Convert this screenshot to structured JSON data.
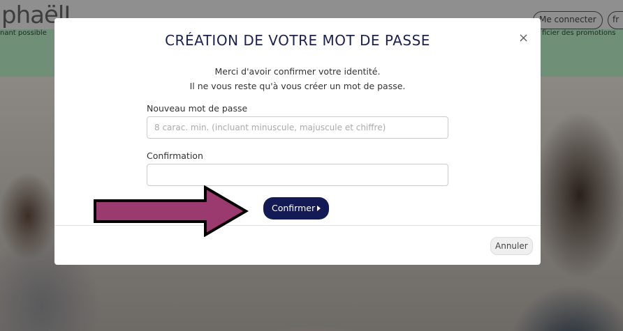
{
  "background": {
    "logo": "phaëlL",
    "login_button": "Me connecter",
    "lang_button": "fr",
    "banner_left": "nant possible",
    "banner_right": "ficier des promotions"
  },
  "modal": {
    "title": "CRÉATION DE VOTRE MOT DE PASSE",
    "close_icon": "×",
    "message_line1": "Merci d'avoir confirmer votre identité.",
    "message_line2": "Il ne vous reste qu'à vous créer un mot de passe.",
    "new_password": {
      "label": "Nouveau mot de passe",
      "placeholder": "8 carac. min. (incluant minuscule, majuscule et chiffre)",
      "value": ""
    },
    "confirmation": {
      "label": "Confirmation",
      "placeholder": "",
      "value": ""
    },
    "confirm_button": "Confirmer",
    "cancel_button": "Annuler"
  },
  "annotation": {
    "arrow_color": "#9b3a6e"
  },
  "colors": {
    "primary": "#141a55",
    "title": "#1a2050",
    "overlay": "#7a7672"
  }
}
